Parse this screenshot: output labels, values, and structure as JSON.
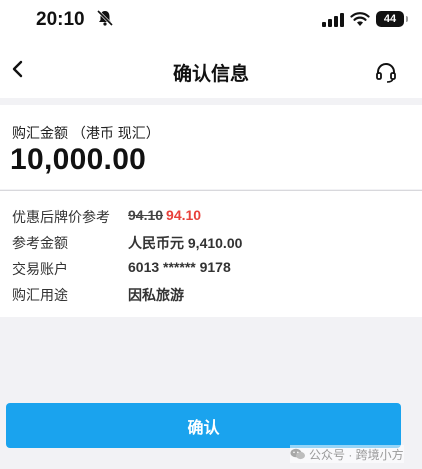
{
  "status_bar": {
    "time": "20:10",
    "battery": "44"
  },
  "nav": {
    "title": "确认信息"
  },
  "amount": {
    "label": "购汇金额 （港币 现汇）",
    "value": "10,000.00"
  },
  "details": {
    "rate": {
      "label": "优惠后牌价参考",
      "old": "94.10",
      "new": "94.10"
    },
    "reference": {
      "label": "参考金额",
      "value": "人民币元 9,410.00"
    },
    "account": {
      "label": "交易账户",
      "value": "6013 ****** 9178"
    },
    "purpose": {
      "label": "购汇用途",
      "value": "因私旅游"
    }
  },
  "confirm_button": {
    "label": "确认"
  },
  "watermark": {
    "text": "公众号 · 跨境小方"
  },
  "colors": {
    "accent": "#1aa3ee",
    "price_highlight": "#e8403a",
    "background": "#f2f2f5"
  },
  "icons": [
    "bell-slash-icon",
    "signal-icon",
    "wifi-icon",
    "battery-icon",
    "back-chevron-icon",
    "headset-icon",
    "wechat-icon"
  ]
}
